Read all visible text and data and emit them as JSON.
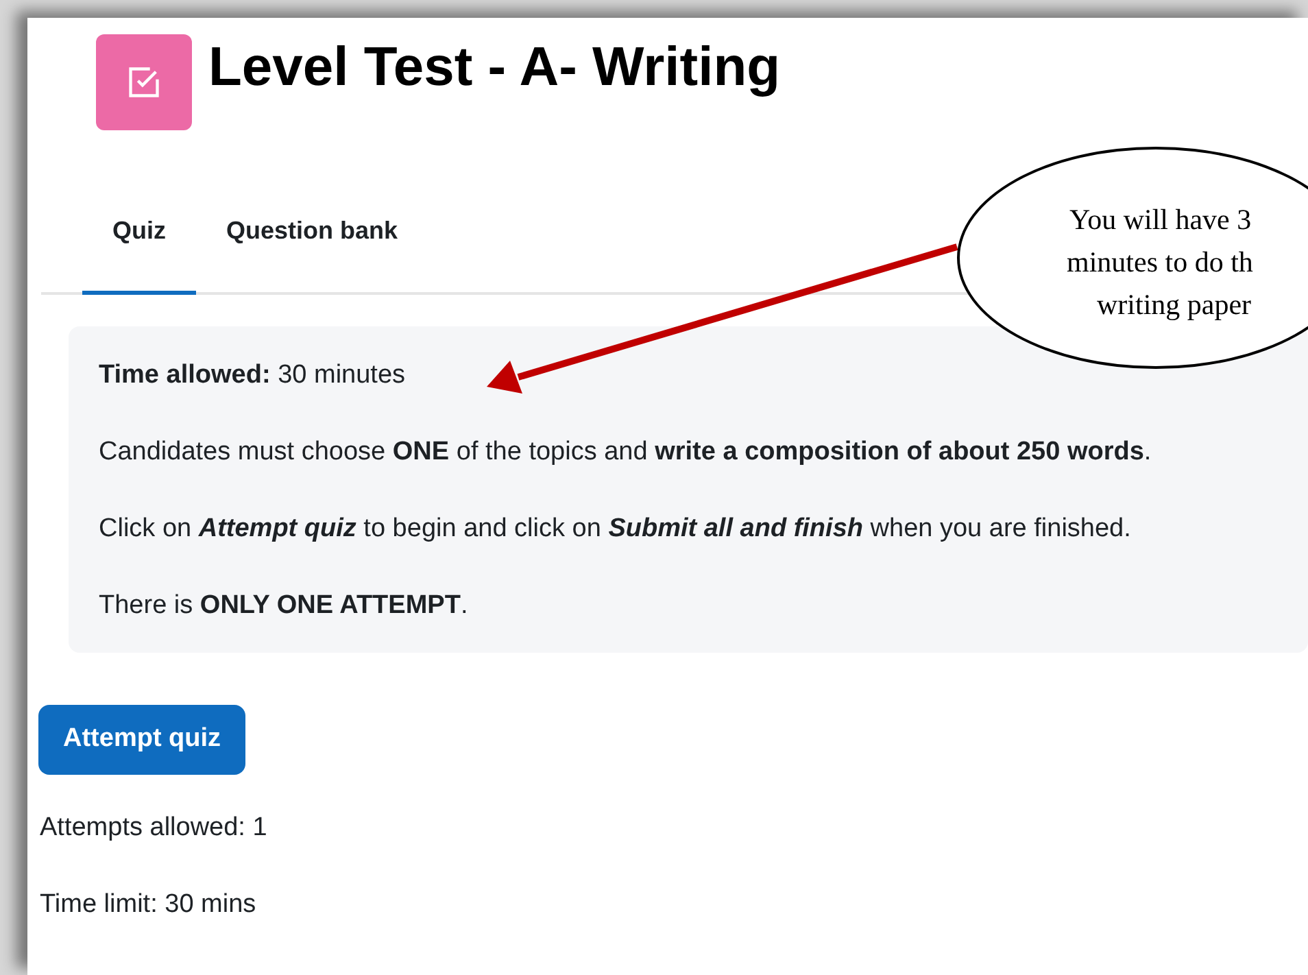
{
  "page": {
    "title": "Level Test - A- Writing"
  },
  "tabs": [
    {
      "label": "Quiz",
      "selected": true
    },
    {
      "label": "Question bank",
      "selected": false
    }
  ],
  "info_box": {
    "paragraphs": [
      "**Time allowed:** 30 minutes",
      "Candidates must choose **ONE** of the topics and **write a composition of about 250 words**.",
      [
        {
          "text": "Click on "
        },
        {
          "text": "Attempt quiz",
          "bold": true,
          "italic": true
        },
        {
          "text": " to begin and click on "
        },
        {
          "text": "Submit all and finish",
          "bold": true,
          "italic": true
        },
        {
          "text": " when you are finished."
        }
      ],
      "There is **ONLY ONE ATTEMPT**."
    ]
  },
  "attempt_button": "Attempt quiz",
  "details": [
    "Attempts allowed: 1",
    "Time limit: 30 mins"
  ],
  "callout": {
    "lines": [
      "You will have 3",
      "minutes to do th",
      "writing paper"
    ]
  }
}
